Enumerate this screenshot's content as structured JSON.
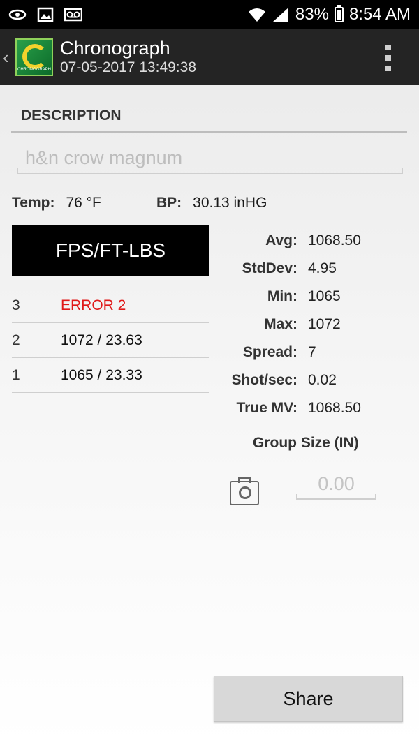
{
  "status_bar": {
    "battery": "83%",
    "time": "8:54 AM",
    "icons": [
      "sync-icon",
      "image-icon",
      "voicemail-icon",
      "wifi-icon",
      "signal-icon",
      "battery-icon"
    ]
  },
  "action_bar": {
    "title": "Chronograph",
    "subtitle": "07-05-2017 13:49:38",
    "logo_text": "CHRONOGRAPH"
  },
  "description": {
    "heading": "DESCRIPTION",
    "placeholder": "h&n crow magnum"
  },
  "environment": {
    "temp_label": "Temp:",
    "temp_value": "76 °F",
    "bp_label": "BP:",
    "bp_value": "30.13 inHG"
  },
  "unit_button": "FPS/FT-LBS",
  "shots": [
    {
      "num": "3",
      "value": "ERROR 2",
      "error": true
    },
    {
      "num": "2",
      "value": "1072 / 23.63",
      "error": false
    },
    {
      "num": "1",
      "value": "1065 / 23.33",
      "error": false
    }
  ],
  "stats": [
    {
      "label": "Avg:",
      "value": "1068.50"
    },
    {
      "label": "StdDev:",
      "value": "4.95"
    },
    {
      "label": "Min:",
      "value": "1065"
    },
    {
      "label": "Max:",
      "value": "1072"
    },
    {
      "label": "Spread:",
      "value": "7"
    },
    {
      "label": "Shot/sec:",
      "value": "0.02"
    },
    {
      "label": "True MV:",
      "value": "1068.50"
    }
  ],
  "group": {
    "label": "Group Size (IN)",
    "placeholder": "0.00"
  },
  "share_button": "Share",
  "colors": {
    "error": "#e01919",
    "action_bar": "#242424",
    "status_bar": "#000000"
  }
}
